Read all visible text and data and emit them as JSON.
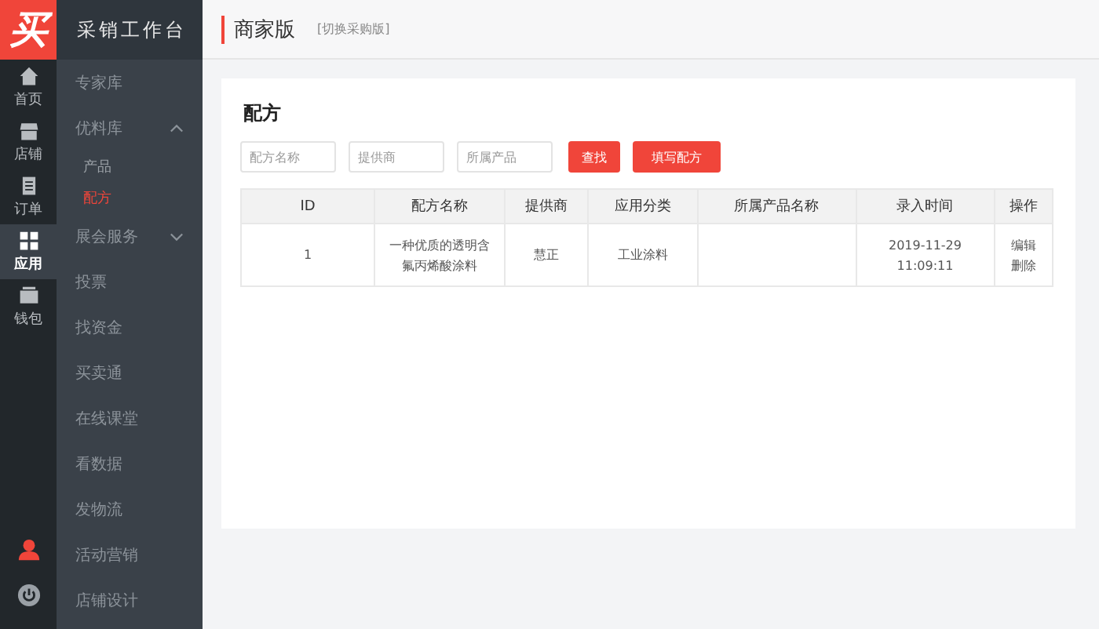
{
  "logo": {
    "text": "买"
  },
  "rail": [
    {
      "label": "首页",
      "selected": false
    },
    {
      "label": "店铺",
      "selected": false
    },
    {
      "label": "订单",
      "selected": false
    },
    {
      "label": "应用",
      "selected": true
    },
    {
      "label": "钱包",
      "selected": false
    }
  ],
  "sidebar": {
    "title": "采销工作台",
    "items": [
      {
        "label": "专家库"
      },
      {
        "label": "优料库",
        "expanded": true,
        "children": [
          {
            "label": "产品",
            "selected": false
          },
          {
            "label": "配方",
            "selected": true
          }
        ]
      },
      {
        "label": "展会服务",
        "expanded": false
      },
      {
        "label": "投票"
      },
      {
        "label": "找资金"
      },
      {
        "label": "买卖通"
      },
      {
        "label": "在线课堂"
      },
      {
        "label": "看数据"
      },
      {
        "label": "发物流"
      },
      {
        "label": "活动营销"
      },
      {
        "label": "店铺设计"
      }
    ]
  },
  "header": {
    "title": "商家版",
    "switch_link": "[切换采购版]"
  },
  "page": {
    "title": "配方",
    "filters": [
      {
        "placeholder": "配方名称"
      },
      {
        "placeholder": "提供商"
      },
      {
        "placeholder": "所属产品"
      }
    ],
    "buttons": [
      "查找",
      "填写配方"
    ],
    "table": {
      "columns": [
        "ID",
        "配方名称",
        "提供商",
        "应用分类",
        "所属产品名称",
        "录入时间",
        "操作"
      ],
      "rows": [
        {
          "id": "1",
          "name": "一种优质的透明含氟丙烯酸涂料",
          "supplier": "慧正",
          "category": "工业涂料",
          "time": [
            "2019-11-29",
            "11:09:11"
          ],
          "actions": [
            "编辑",
            "删除"
          ]
        }
      ]
    }
  }
}
